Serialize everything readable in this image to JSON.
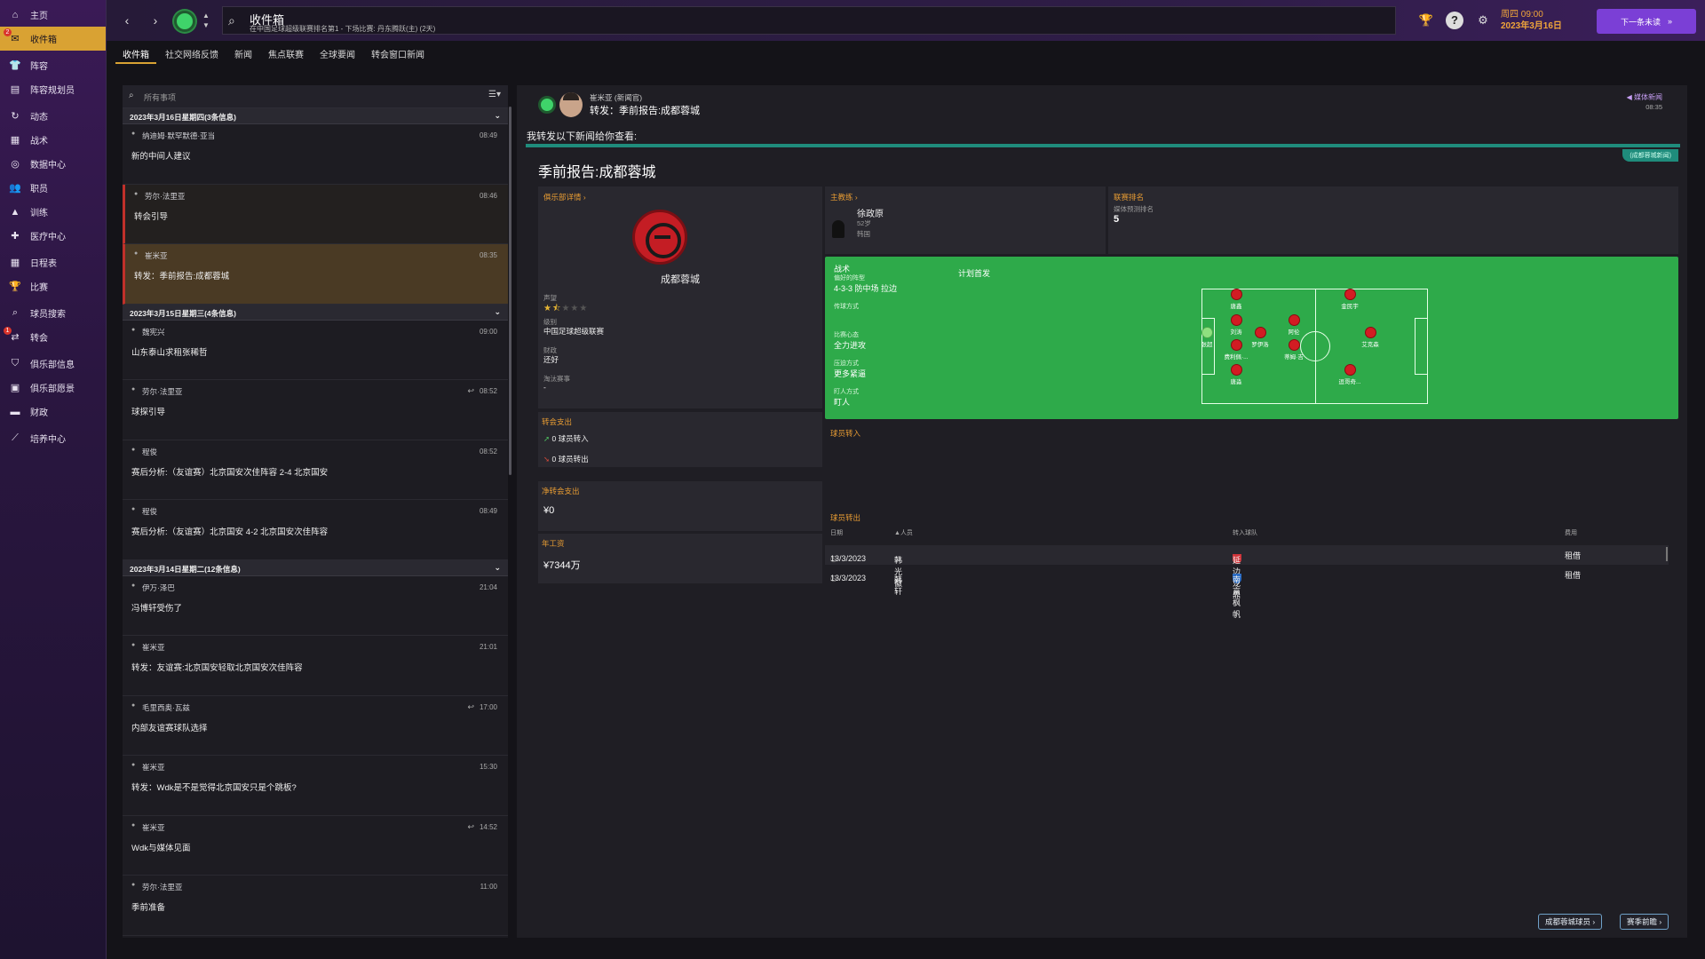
{
  "sidebar": {
    "items": [
      {
        "label": "主页",
        "icon": "home-icon",
        "active": false
      },
      {
        "label": "收件箱",
        "icon": "inbox-icon",
        "active": true,
        "badge": "2"
      },
      {
        "label": "阵容",
        "icon": "shirt-icon",
        "active": false
      },
      {
        "label": "阵容规划员",
        "icon": "clipboard-icon",
        "active": false
      },
      {
        "label": "动态",
        "icon": "refresh-icon",
        "active": false
      },
      {
        "label": "战术",
        "icon": "tactics-board-icon",
        "active": false
      },
      {
        "label": "数据中心",
        "icon": "data-icon",
        "active": false
      },
      {
        "label": "职员",
        "icon": "staff-icon",
        "active": false
      },
      {
        "label": "训练",
        "icon": "cone-icon",
        "active": false
      },
      {
        "label": "医疗中心",
        "icon": "medical-icon",
        "active": false
      },
      {
        "label": "日程表",
        "icon": "calendar-icon",
        "active": false
      },
      {
        "label": "比赛",
        "icon": "trophy-icon",
        "active": false
      },
      {
        "label": "球员搜索",
        "icon": "search-icon",
        "active": false
      },
      {
        "label": "转会",
        "icon": "transfer-icon",
        "active": false,
        "badge": "1"
      },
      {
        "label": "俱乐部信息",
        "icon": "shield-icon",
        "active": false
      },
      {
        "label": "俱乐部愿景",
        "icon": "vision-icon",
        "active": false
      },
      {
        "label": "财政",
        "icon": "finance-icon",
        "active": false
      },
      {
        "label": "培养中心",
        "icon": "development-icon",
        "active": false
      }
    ]
  },
  "topbar": {
    "title": "收件箱",
    "subtitle": "在中国足球超级联赛排名第1 - 下场比赛: 丹东腾跃(主) (2天)",
    "date_line1": "周四 09:00",
    "date_line2": "2023年3月16日",
    "continue_label": "下一条未读"
  },
  "tabs": [
    {
      "label": "收件箱",
      "active": true
    },
    {
      "label": "社交网络反馈"
    },
    {
      "label": "新闻"
    },
    {
      "label": "焦点联赛"
    },
    {
      "label": "全球要闻"
    },
    {
      "label": "转会窗口新闻"
    }
  ],
  "inbox": {
    "filter_placeholder": "所有事项",
    "groups": [
      {
        "header": "2023年3月16日星期四(3条信息)",
        "messages": [
          {
            "from": "纳迪姆·默罕默德·亚当",
            "time": "08:49",
            "subject": "新的中间人建议",
            "style": "normal"
          },
          {
            "from": "劳尔·法里亚",
            "time": "08:46",
            "subject": "转会引导",
            "style": "red"
          },
          {
            "from": "崔米亚",
            "time": "08:35",
            "subject": "转发：季前报告:成都蓉城",
            "style": "selected"
          }
        ]
      },
      {
        "header": "2023年3月15日星期三(4条信息)",
        "messages": [
          {
            "from": "魏宪兴",
            "time": "09:00",
            "subject": "山东泰山求租张稀哲",
            "style": "normal"
          },
          {
            "from": "劳尔·法里亚",
            "time": "08:52",
            "subject": "球探引导",
            "style": "normal",
            "replied": true
          },
          {
            "from": "程俊",
            "time": "08:52",
            "subject": "赛后分析:（友谊赛）北京国安次佳阵容 2-4 北京国安",
            "style": "normal"
          },
          {
            "from": "程俊",
            "time": "08:49",
            "subject": "赛后分析:（友谊赛）北京国安 4-2 北京国安次佳阵容",
            "style": "normal"
          }
        ]
      },
      {
        "header": "2023年3月14日星期二(12条信息)",
        "messages": [
          {
            "from": "伊万·泽巴",
            "time": "21:04",
            "subject": "冯博轩受伤了",
            "style": "normal"
          },
          {
            "from": "崔米亚",
            "time": "21:01",
            "subject": "转发：友谊赛:北京国安轻取北京国安次佳阵容",
            "style": "normal"
          },
          {
            "from": "毛里西奥·瓦兹",
            "time": "17:00",
            "subject": "内部友谊赛球队选择",
            "style": "normal",
            "replied": true
          },
          {
            "from": "崔米亚",
            "time": "15:30",
            "subject": "转发：Wdk是不是觉得北京国安只是个跳板?",
            "style": "normal"
          },
          {
            "from": "崔米亚",
            "time": "14:52",
            "subject": "Wdk与媒体见面",
            "style": "normal",
            "replied": true
          },
          {
            "from": "劳尔·法里亚",
            "time": "11:00",
            "subject": "季前准备",
            "style": "normal"
          }
        ]
      }
    ]
  },
  "detail": {
    "sender": "崔米亚 (新闻官)",
    "subject": "转发：季前报告:成都蓉城",
    "tag": "媒体新闻",
    "time": "08:35",
    "intro": "我转发以下新闻给你查看:",
    "source_tag": "(成都蓉城新闻)",
    "article_title": "季前报告:成都蓉城",
    "club": {
      "header": "俱乐部详情",
      "name": "成都蓉城",
      "reputation_label": "声望",
      "reputation_stars": 1.5,
      "division_label": "级别",
      "division": "中国足球超级联赛",
      "finance_label": "财政",
      "finance": "还好",
      "eliminated_label": "淘汰赛事",
      "eliminated": "-"
    },
    "manager": {
      "header": "主教练",
      "name": "徐政原",
      "age": "52岁",
      "nation": "韩国"
    },
    "ranking": {
      "header": "联赛排名",
      "sub": "媒体预测排名",
      "value": "5"
    },
    "tactics": {
      "header": "战术",
      "formation_label": "偏好的阵型",
      "formation": "4-3-3 防中场 拉边",
      "passing_label": "传球方式",
      "passing": "",
      "mentality_label": "比赛心态",
      "mentality": "全力进攻",
      "pressing_label": "压迫方式",
      "pressing": "更多紧逼",
      "marking_label": "盯人方式",
      "marking": "盯人",
      "lineup_title": "计划首发",
      "players": [
        {
          "name": "张超",
          "gk": true
        },
        {
          "name": "唐鑫"
        },
        {
          "name": "刘涛"
        },
        {
          "name": "费利佩·..."
        },
        {
          "name": "唐淼"
        },
        {
          "name": "罗伊洛"
        },
        {
          "name": "阿伦"
        },
        {
          "name": "蒂姆·吉"
        },
        {
          "name": "金民宇"
        },
        {
          "name": "艾克森"
        },
        {
          "name": "逗哥奇..."
        }
      ]
    },
    "transfer_spend": {
      "header": "转会支出",
      "in": "0 球员转入",
      "out": "0 球员转出"
    },
    "net_spend": {
      "header": "净转会支出",
      "value": "¥0"
    },
    "wages": {
      "header": "年工资",
      "value": "¥7344万"
    },
    "players_in": {
      "header": "球员转入"
    },
    "players_out": {
      "header": "球员转出",
      "cols": [
        "日期",
        "人员",
        "转入球队",
        "费用"
      ],
      "rows": [
        {
          "date": "13/3/2023",
          "player": "韩光徽",
          "team": "延边龙鼎",
          "fee": "租借",
          "crest_color": "#d0343a"
        },
        {
          "date": "13/3/2023",
          "player": "韩轩",
          "team": "南京枫帆",
          "fee": "租借",
          "crest_color": "#2b6cc4"
        }
      ]
    },
    "buttons": {
      "squad": "成都蓉城球员",
      "preview": "赛季前瞻"
    }
  }
}
